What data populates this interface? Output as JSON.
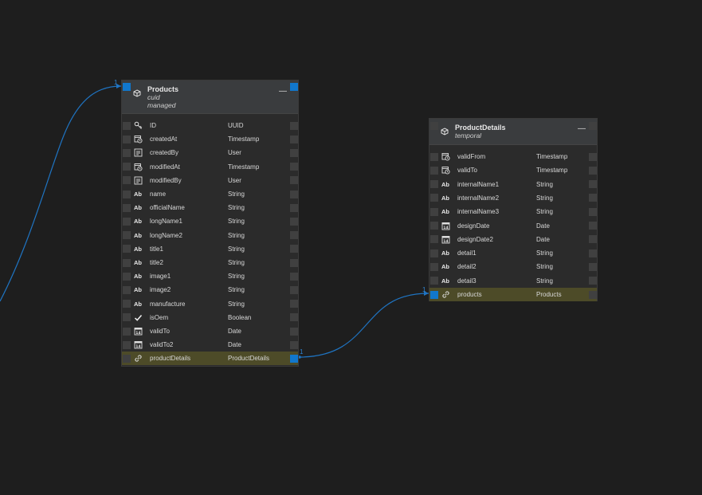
{
  "colors": {
    "background": "#1e1e1e",
    "header": "#3a3c3e",
    "body": "#2b2b2b",
    "port_active": "#1177cc",
    "port_inactive": "#404040",
    "highlight_row": "#4d4b28",
    "connector": "#1f74c2"
  },
  "entities": [
    {
      "id": "products",
      "title": "Products",
      "tags": [
        "cuid",
        "managed"
      ],
      "fields": [
        {
          "name": "ID",
          "type": "UUID",
          "icon": "key-icon"
        },
        {
          "name": "createdAt",
          "type": "Timestamp",
          "icon": "clock-calendar-icon"
        },
        {
          "name": "createdBy",
          "type": "User",
          "icon": "user-card-icon"
        },
        {
          "name": "modifiedAt",
          "type": "Timestamp",
          "icon": "clock-calendar-icon"
        },
        {
          "name": "modifiedBy",
          "type": "User",
          "icon": "user-card-icon"
        },
        {
          "name": "name",
          "type": "String",
          "icon": "text-icon"
        },
        {
          "name": "officialName",
          "type": "String",
          "icon": "text-icon"
        },
        {
          "name": "longName1",
          "type": "String",
          "icon": "text-icon"
        },
        {
          "name": "longName2",
          "type": "String",
          "icon": "text-icon"
        },
        {
          "name": "title1",
          "type": "String",
          "icon": "text-icon"
        },
        {
          "name": "title2",
          "type": "String",
          "icon": "text-icon"
        },
        {
          "name": "image1",
          "type": "String",
          "icon": "text-icon"
        },
        {
          "name": "image2",
          "type": "String",
          "icon": "text-icon"
        },
        {
          "name": "manufacture",
          "type": "String",
          "icon": "text-icon"
        },
        {
          "name": "isOem",
          "type": "Boolean",
          "icon": "check-icon"
        },
        {
          "name": "validTo",
          "type": "Date",
          "icon": "calendar-icon"
        },
        {
          "name": "validTo2",
          "type": "Date",
          "icon": "calendar-icon"
        },
        {
          "name": "productDetails",
          "type": "ProductDetails",
          "icon": "link-icon",
          "association": true
        }
      ]
    },
    {
      "id": "productdetails",
      "title": "ProductDetails",
      "tags": [
        "temporal"
      ],
      "fields": [
        {
          "name": "validFrom",
          "type": "Timestamp",
          "icon": "clock-calendar-icon"
        },
        {
          "name": "validTo",
          "type": "Timestamp",
          "icon": "clock-calendar-icon"
        },
        {
          "name": "internalName1",
          "type": "String",
          "icon": "text-icon"
        },
        {
          "name": "internalName2",
          "type": "String",
          "icon": "text-icon"
        },
        {
          "name": "internalName3",
          "type": "String",
          "icon": "text-icon"
        },
        {
          "name": "designDate",
          "type": "Date",
          "icon": "calendar-icon"
        },
        {
          "name": "designDate2",
          "type": "Date",
          "icon": "calendar-icon"
        },
        {
          "name": "detail1",
          "type": "String",
          "icon": "text-icon"
        },
        {
          "name": "detail2",
          "type": "String",
          "icon": "text-icon"
        },
        {
          "name": "detail3",
          "type": "String",
          "icon": "text-icon"
        },
        {
          "name": "products",
          "type": "Products",
          "icon": "link-icon",
          "association": true
        }
      ]
    }
  ],
  "connectors": [
    {
      "from": "products.productDetails",
      "to": "productdetails.products",
      "from_label": "1",
      "to_label": "1"
    },
    {
      "from": "offscreen",
      "to": "products",
      "from_label": "",
      "to_label": "1"
    }
  ],
  "labels": {
    "text_icon_glyph": "Ab",
    "multiplicity_1": "1",
    "minimize_glyph": "—"
  }
}
